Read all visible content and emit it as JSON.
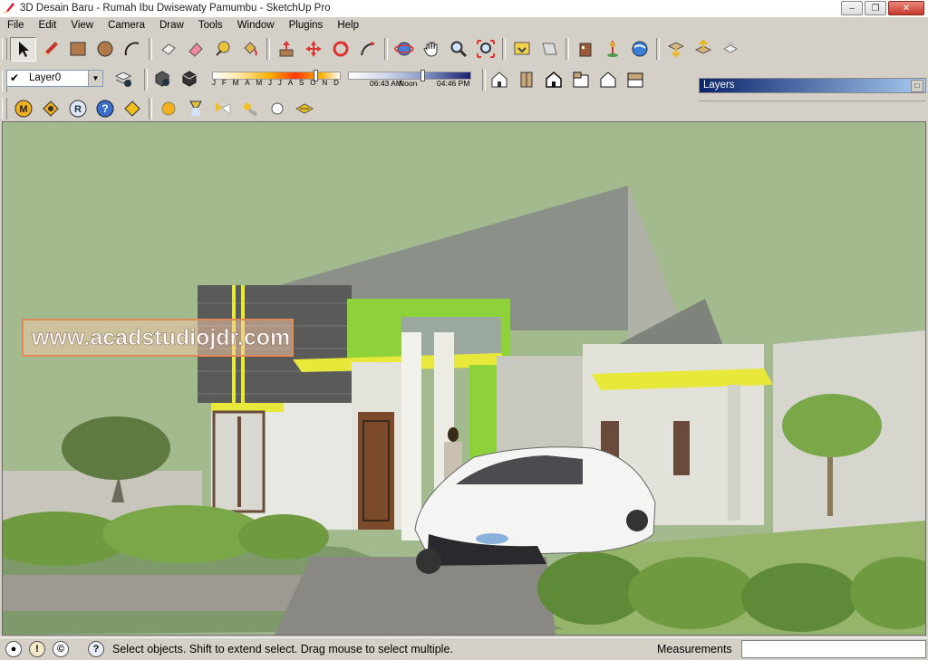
{
  "window": {
    "title": "3D Desain Baru - Rumah Ibu Dwisewaty Pamumbu - SketchUp Pro",
    "minimize_glyph": "–",
    "maximize_glyph": "❐",
    "close_glyph": "✕"
  },
  "menu": [
    "File",
    "Edit",
    "View",
    "Camera",
    "Draw",
    "Tools",
    "Window",
    "Plugins",
    "Help"
  ],
  "toolbar": {
    "layer_current": "Layer0",
    "layer_check": "✔",
    "shadow_months": [
      "J",
      "F",
      "M",
      "A",
      "M",
      "J",
      "J",
      "A",
      "S",
      "O",
      "N",
      "D"
    ],
    "shadow_time_start": "06:43 AM",
    "shadow_time_noon": "Noon",
    "shadow_time_end": "04:46 PM",
    "plugin_letters": {
      "m": "M",
      "r": "R",
      "q": "?"
    }
  },
  "layers_panel": {
    "title": "Layers",
    "button_glyph": "□"
  },
  "viewport": {
    "watermark": "www.acadstudiojdr.com"
  },
  "status": {
    "message": "Select objects. Shift to extend select. Drag mouse to select multiple.",
    "measurements_label": "Measurements",
    "measurements_value": ""
  },
  "colors": {
    "sky": "#a2ba8e",
    "accent_green": "#8ed23a",
    "accent_yellow": "#e8e83a",
    "roof": "#8a8f88",
    "wall": "#e4e4dc"
  }
}
